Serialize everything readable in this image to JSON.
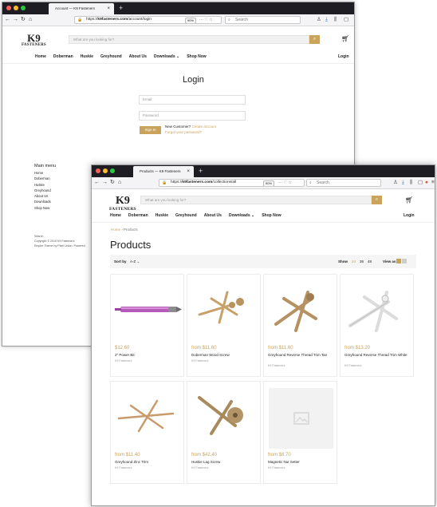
{
  "window_back": {
    "tab_title": "Account — K9 Fasteners",
    "url_prefix": "https://",
    "url_domain": "k9fasteners.com",
    "url_path": "/account/login",
    "zoom": "90%",
    "search_placeholder": "Search",
    "site_search_placeholder": "What are you looking for?",
    "logo_mark": "K9",
    "logo_text": "FASTENERS",
    "nav": [
      "Home",
      "Doberman",
      "Huskie",
      "Greyhound",
      "About Us",
      "Downloads ⌄",
      "Shop Now"
    ],
    "login_link": "Login",
    "heading": "Login",
    "email_placeholder": "Email",
    "password_placeholder": "Password",
    "signin_label": "Sign In",
    "new_customer": "New Customer?",
    "create_account": "Create account",
    "forgot_password": "Forgot your password?",
    "footer_menu_title": "Main menu",
    "footer_links": [
      "Home",
      "Doberman",
      "Huskie",
      "Greyhound",
      "About Us",
      "Downloads",
      "Shop Now"
    ],
    "footer_search": "Search",
    "copyright": "Copyright © 2019 K9 Fasteners",
    "theme_credit": "Empire Theme by Pixel Union. Powered"
  },
  "window_front": {
    "tab_title": "Products — K9 Fasteners",
    "url_prefix": "https://",
    "url_domain": "k9fasteners.com",
    "url_path": "/collections/all",
    "zoom": "90%",
    "search_placeholder": "Search",
    "site_search_placeholder": "What are you looking for?",
    "logo_mark": "K9",
    "logo_text": "FASTENERS",
    "nav": [
      "Home",
      "Doberman",
      "Huskie",
      "Greyhound",
      "About Us",
      "Downloads ⌄",
      "Shop Now"
    ],
    "login_link": "Login",
    "breadcrumb_home": "Home",
    "breadcrumb_sep": "›",
    "breadcrumb_current": "Products",
    "heading": "Products",
    "sort_label": "Sort by",
    "sort_value": "A-Z",
    "show_label": "Show",
    "show_options": [
      "24",
      "36",
      "48"
    ],
    "view_label": "View as",
    "products": [
      {
        "price": "$12.60",
        "name": "2\" Power Bit",
        "vendor": "K9 Fasteners"
      },
      {
        "price": "from $11.60",
        "name": "Doberman Wood Screw",
        "vendor": "K9 Fasteners"
      },
      {
        "price": "from $11.60",
        "name": "Greyhound Reverse Thread Trim Tan",
        "vendor": "K9 Fasteners"
      },
      {
        "price": "from $13.20",
        "name": "Greyhound Reverse Thread Trim White",
        "vendor": "K9 Fasteners"
      },
      {
        "price": "from $11.40",
        "name": "Greyhound Zinc Trim",
        "vendor": "K9 Fasteners"
      },
      {
        "price": "from $42.40",
        "name": "Huskie Lag Screw",
        "vendor": "K9 Fasteners"
      },
      {
        "price": "from $8.70",
        "name": "Magnetic Nut Setter",
        "vendor": "K9 Fasteners"
      }
    ]
  },
  "colors": {
    "accent_gold": "#c9a35c",
    "tabbar_dark": "#1e1d24",
    "dot_red": "#ff5f57",
    "dot_yellow": "#febc2e",
    "dot_green": "#28c840",
    "bit_purple": "#b45bb8"
  }
}
